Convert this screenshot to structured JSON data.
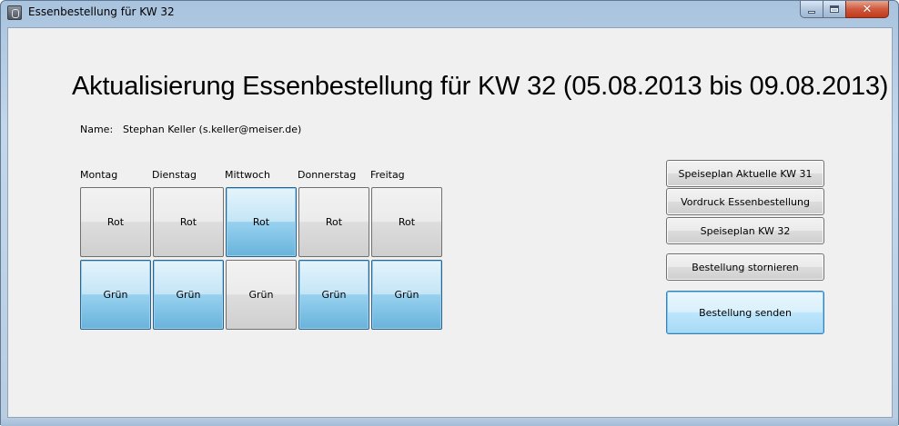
{
  "window": {
    "title": "Essenbestellung für KW 32",
    "controls": {
      "minimize": "minimize-icon",
      "maximize": "maximize-icon",
      "close": "close-icon"
    }
  },
  "main": {
    "heading": "Aktualisierung  Essenbestellung für KW 32 (05.08.2013 bis 09.08.2013)",
    "name_label": "Name:",
    "name_value": "Stephan Keller (s.keller@meiser.de)"
  },
  "days": [
    {
      "label": "Montag",
      "rot": {
        "label": "Rot",
        "selected": false
      },
      "gruen": {
        "label": "Grün",
        "selected": true
      }
    },
    {
      "label": "Dienstag",
      "rot": {
        "label": "Rot",
        "selected": false
      },
      "gruen": {
        "label": "Grün",
        "selected": true
      }
    },
    {
      "label": "Mittwoch",
      "rot": {
        "label": "Rot",
        "selected": true
      },
      "gruen": {
        "label": "Grün",
        "selected": false
      }
    },
    {
      "label": "Donnerstag",
      "rot": {
        "label": "Rot",
        "selected": false
      },
      "gruen": {
        "label": "Grün",
        "selected": true
      }
    },
    {
      "label": "Freitag",
      "rot": {
        "label": "Rot",
        "selected": false
      },
      "gruen": {
        "label": "Grün",
        "selected": true
      }
    }
  ],
  "actions": {
    "menu_current": "Speiseplan Aktuelle KW 31",
    "order_form": "Vordruck Essenbestellung",
    "menu_next": "Speiseplan KW 32",
    "cancel_order": "Bestellung stornieren",
    "send_order": "Bestellung senden"
  },
  "colors": {
    "selected_button": "#98d1ef",
    "unselected_button": "#dddddd",
    "client_background": "#f0f0f0",
    "close_button": "#c2391a"
  }
}
